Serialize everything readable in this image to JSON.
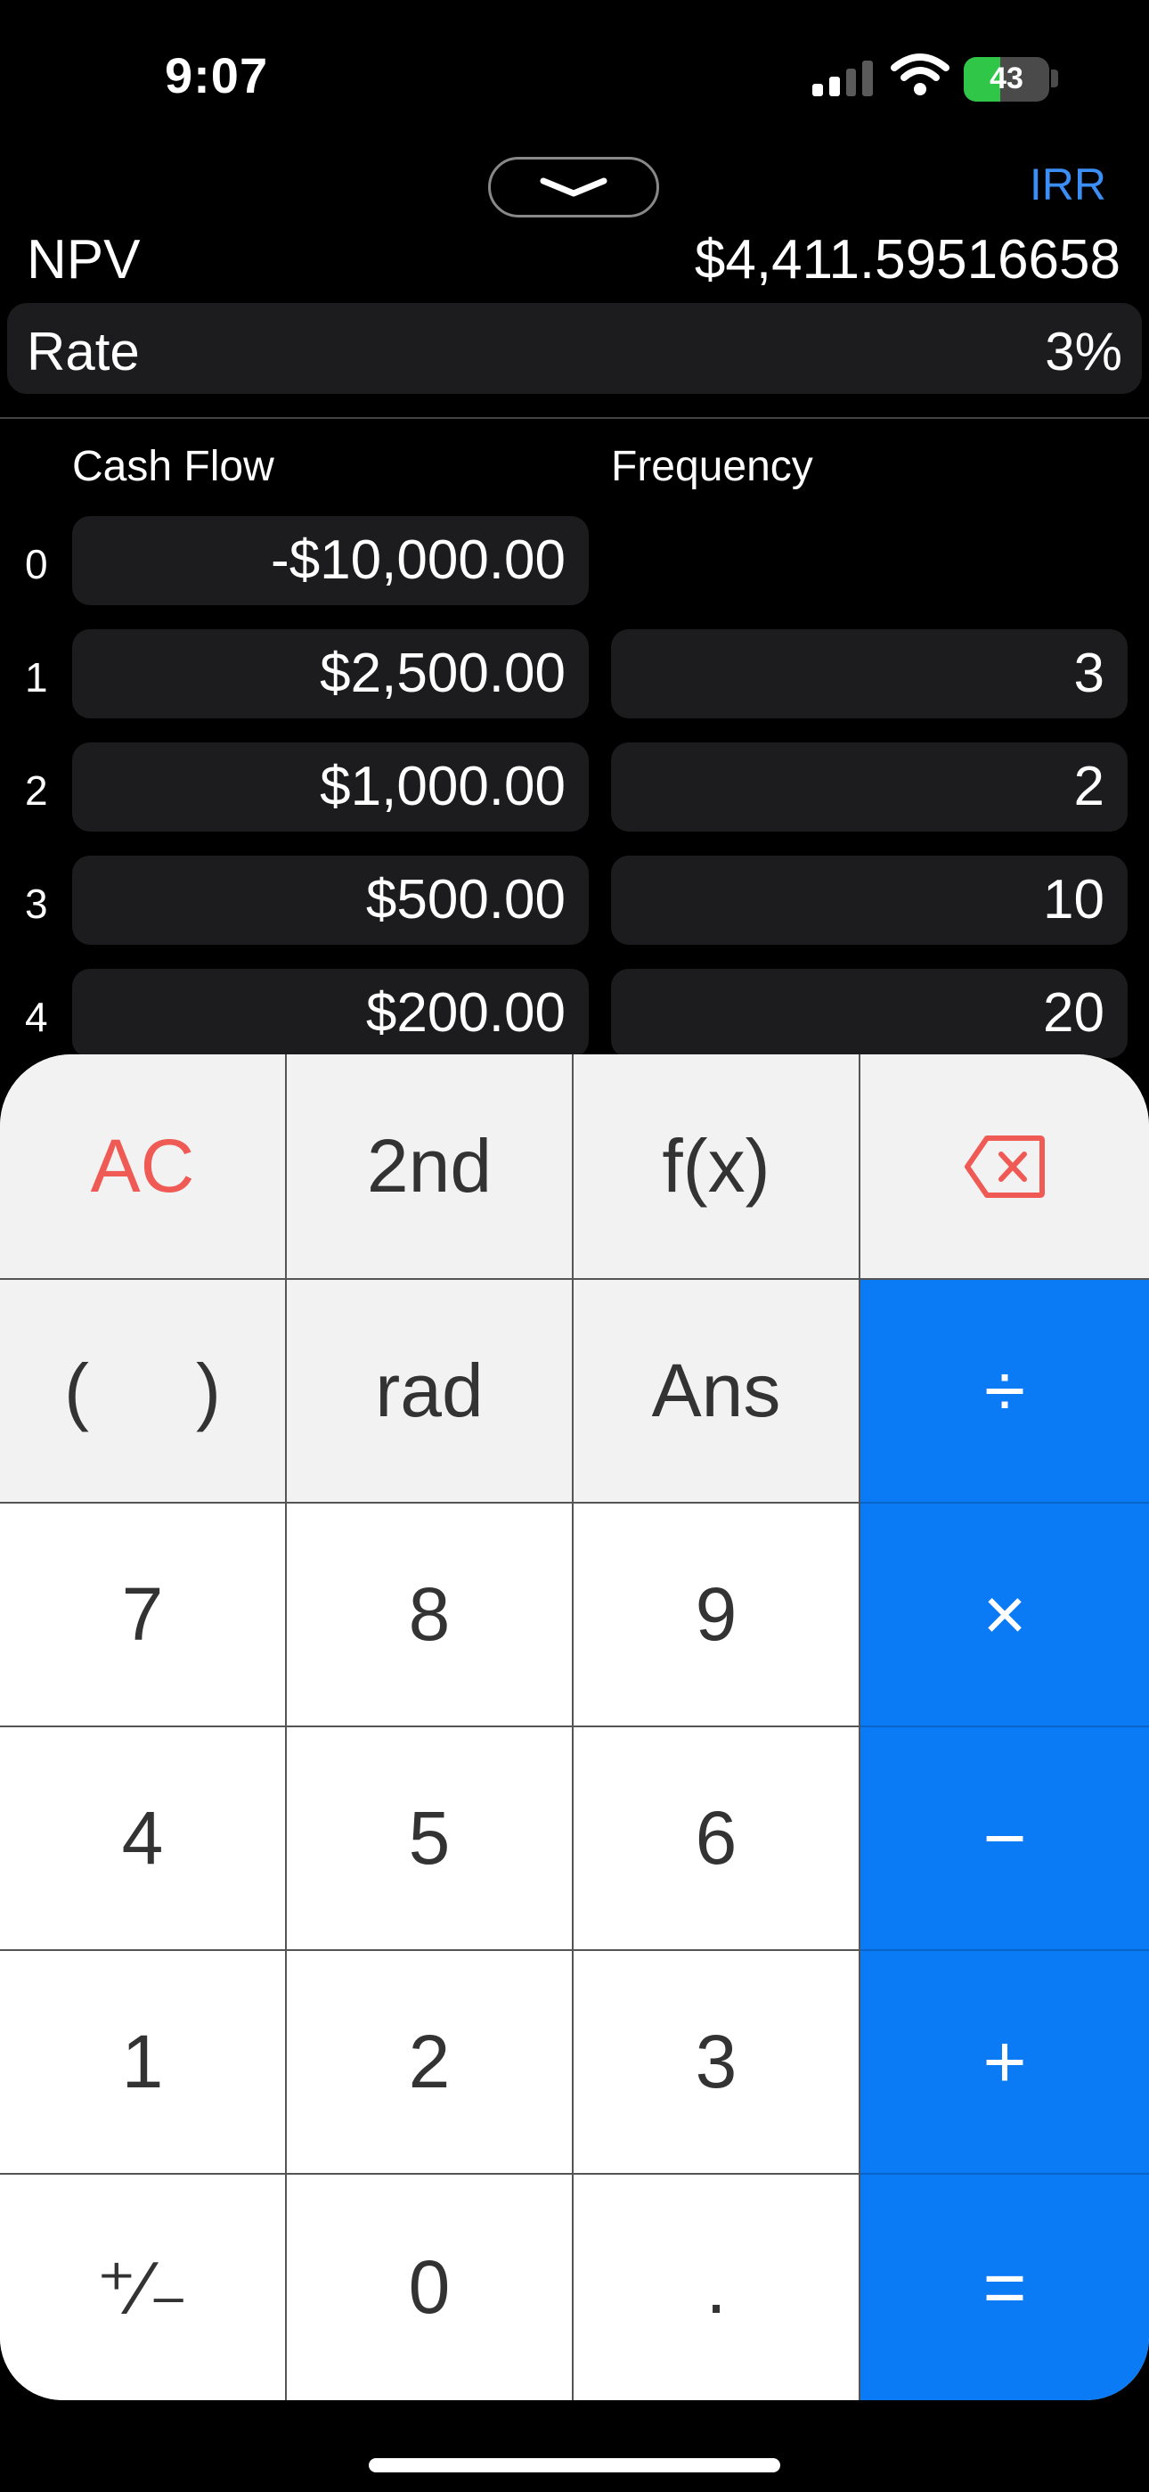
{
  "status_bar": {
    "time": "9:07",
    "battery": "43"
  },
  "header": {
    "irr_label": "IRR",
    "npv_label": "NPV",
    "npv_value": "$4,411.59516658",
    "rate_label": "Rate",
    "rate_value": "3%"
  },
  "table": {
    "cash_flow_header": "Cash Flow",
    "frequency_header": "Frequency",
    "rows": [
      {
        "index": "0",
        "cash_flow": "-$10,000.00",
        "frequency": ""
      },
      {
        "index": "1",
        "cash_flow": "$2,500.00",
        "frequency": "3"
      },
      {
        "index": "2",
        "cash_flow": "$1,000.00",
        "frequency": "2"
      },
      {
        "index": "3",
        "cash_flow": "$500.00",
        "frequency": "10"
      },
      {
        "index": "4",
        "cash_flow": "$200.00",
        "frequency": "20"
      }
    ]
  },
  "keypad": {
    "ac": "AC",
    "second": "2nd",
    "fx": "f(x)",
    "paren_open": "(",
    "paren_close": ")",
    "rad": "rad",
    "ans": "Ans",
    "divide": "÷",
    "seven": "7",
    "eight": "8",
    "nine": "9",
    "multiply": "×",
    "four": "4",
    "five": "5",
    "six": "6",
    "minus": "−",
    "one": "1",
    "two": "2",
    "three": "3",
    "plus": "+",
    "plus_minus": "⁺∕₋",
    "zero": "0",
    "decimal": ".",
    "equals": "="
  },
  "colors": {
    "accent_blue": "#0a7af5",
    "clear_red": "#ef5a55",
    "irr_blue": "#3a8ef5"
  }
}
